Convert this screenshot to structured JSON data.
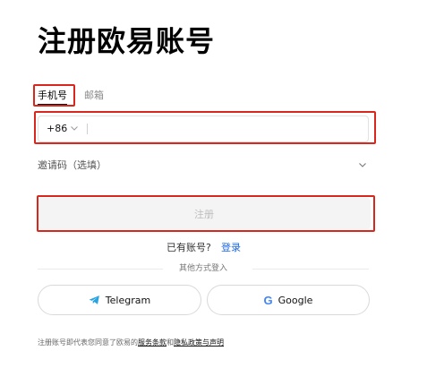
{
  "page": {
    "title": "注册欧易账号"
  },
  "tabs": [
    {
      "label": "手机号",
      "active": true
    },
    {
      "label": "邮箱",
      "active": false
    }
  ],
  "phone_field": {
    "country_code": "+86",
    "value": ""
  },
  "invite": {
    "label": "邀请码（选填）"
  },
  "register_button": {
    "label": "注册"
  },
  "login_prompt": {
    "text": "已有账号?",
    "link": "登录"
  },
  "other_methods": {
    "label": "其他方式登入"
  },
  "social": [
    {
      "label": "Telegram",
      "icon": "telegram-icon"
    },
    {
      "label": "Google",
      "icon": "google-icon"
    }
  ],
  "terms": {
    "prefix": "注册账号即代表您同意了欧易的",
    "terms_link": "服务条款",
    "joiner": "和",
    "privacy_link": "隐私政策与声明"
  },
  "colors": {
    "highlight": "#d9271e",
    "link": "#1a67e8",
    "telegram": "#2aa3e0",
    "button_disabled_bg": "#f4f4f4"
  }
}
